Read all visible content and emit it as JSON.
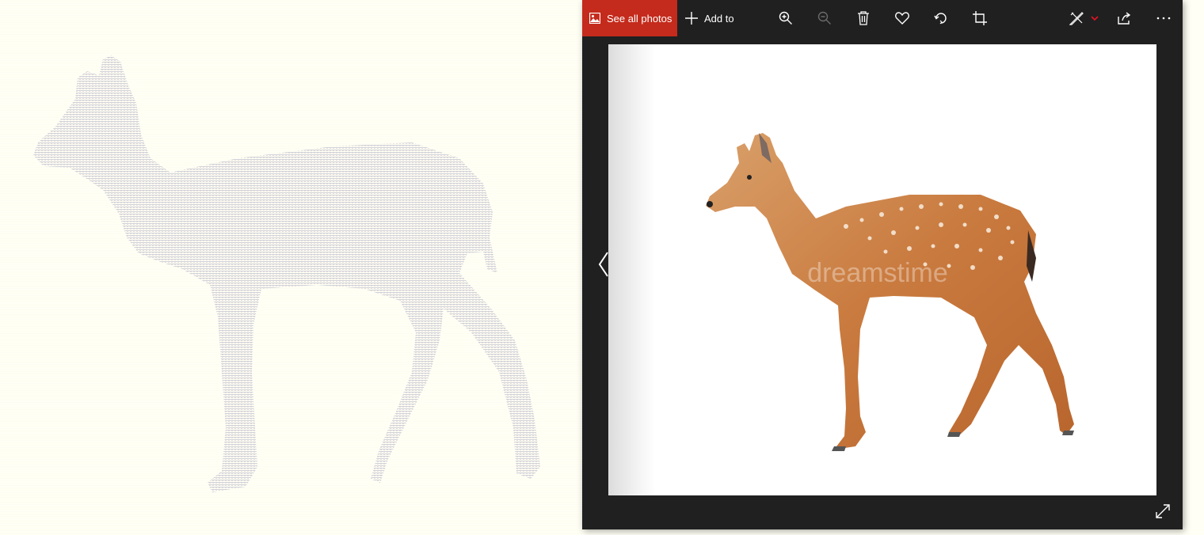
{
  "window": {
    "see_all_photos_label": "See all photos",
    "add_to_label": "Add to"
  },
  "toolbar_icons": [
    "photos-icon",
    "plus-icon",
    "zoom-in-icon",
    "zoom-out-icon",
    "delete-icon",
    "favorite-icon",
    "rotate-icon",
    "crop-icon",
    "edit-draw-icon",
    "chevron-down-icon",
    "share-icon",
    "more-icon"
  ],
  "viewer": {
    "watermark": "dreamstime",
    "subject": "fawn",
    "nav_icons": [
      "chevron-left-icon",
      "expand-icon"
    ]
  },
  "colors": {
    "accent": "#c42b1c",
    "window_bg": "#202020",
    "left_bg": "#fffff5"
  }
}
